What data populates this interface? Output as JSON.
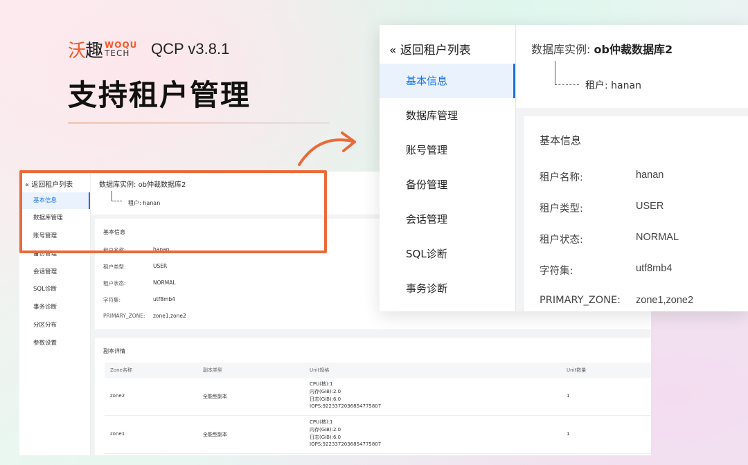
{
  "brand": {
    "cn_left": "沃",
    "cn_right": "趣",
    "en_top": "WOQU",
    "en_bottom": "TECH",
    "version": "QCP v3.8.1"
  },
  "headline": "支持租户管理",
  "colors": {
    "accent": "#1a73e8",
    "highlight": "#ea6a3a",
    "active_bg": "#eaf2fd"
  },
  "sidebar": {
    "back_label": "返回租户列表",
    "back_icon": "double-chevron-left-icon",
    "items": [
      "基本信息",
      "数据库管理",
      "账号管理",
      "备份管理",
      "会话管理",
      "SQL诊断",
      "事务诊断",
      "分区分布",
      "参数设置"
    ],
    "active_index": 0
  },
  "header": {
    "instance_label": "数据库实例:",
    "instance_name": "ob仲裁数据库2",
    "tenant_label": "租户:",
    "tenant_name": "hanan"
  },
  "basic_info": {
    "title": "基本信息",
    "fields": [
      {
        "label": "租户名称:",
        "value": "hanan"
      },
      {
        "label": "租户类型:",
        "value": "USER"
      },
      {
        "label": "租户状态:",
        "value": "NORMAL"
      },
      {
        "label": "字符集:",
        "value": "utf8mb4"
      },
      {
        "label": "PRIMARY_ZONE:",
        "value": "zone1,zone2"
      }
    ]
  },
  "replica": {
    "title": "副本详情",
    "columns": [
      "Zone名称",
      "副本类型",
      "Unit规格",
      "Unit数量"
    ],
    "rows": [
      {
        "zone": "zone2",
        "type": "全能型副本",
        "spec": [
          "CPU(核):1",
          "内存(GiB):2.0",
          "日志(GiB):6.0",
          "IOPS:9223372036854775807"
        ],
        "count": "1"
      },
      {
        "zone": "zone1",
        "type": "全能型副本",
        "spec": [
          "CPU(核):1",
          "内存(GiB):2.0",
          "日志(GiB):6.0",
          "IOPS:9223372036854775807"
        ],
        "count": "1"
      }
    ]
  }
}
